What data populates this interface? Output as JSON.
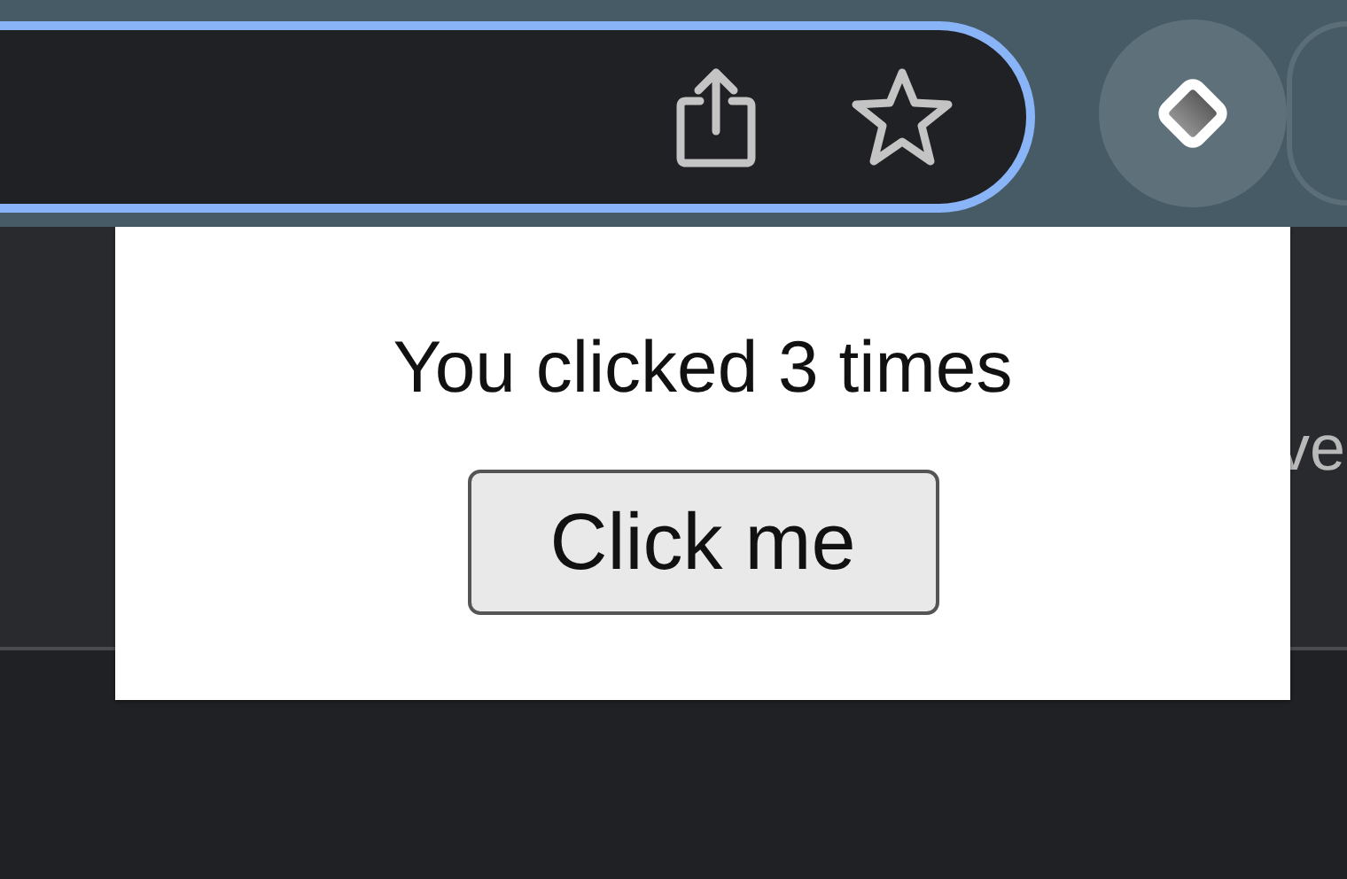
{
  "page": {
    "partial_text": "ve"
  },
  "popup": {
    "message": "You clicked 3 times",
    "button": "Click me"
  }
}
